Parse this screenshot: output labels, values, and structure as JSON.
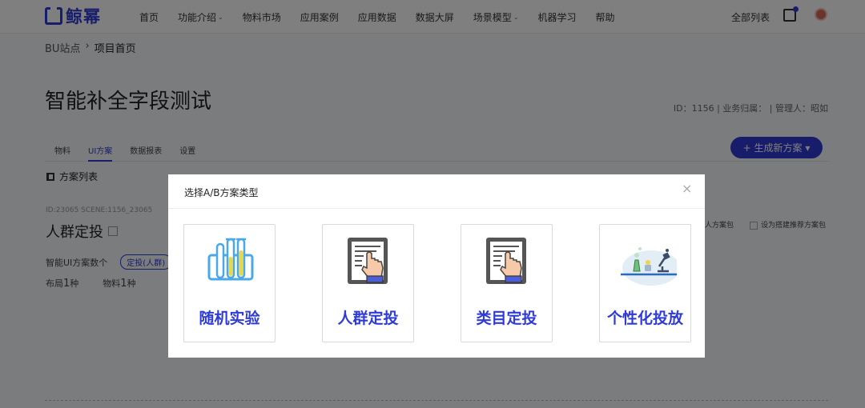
{
  "nav": {
    "logo_text": "鲸幂",
    "items": [
      {
        "label": "首页",
        "caret": ""
      },
      {
        "label": "功能介绍",
        "caret": "⌄"
      },
      {
        "label": "物料市场",
        "caret": ""
      },
      {
        "label": "应用案例",
        "caret": ""
      },
      {
        "label": "应用数据",
        "caret": ""
      },
      {
        "label": "数据大屏",
        "caret": ""
      },
      {
        "label": "场景模型",
        "caret": "⌄"
      },
      {
        "label": "机器学习",
        "caret": ""
      },
      {
        "label": "帮助",
        "caret": ""
      }
    ],
    "all_list": "全部列表"
  },
  "breadcrumb": {
    "root": "BU站点",
    "sep": "›",
    "current": "项目首页"
  },
  "page": {
    "title": "智能补全字段测试",
    "meta": "ID：1156 | 业务归属：  |  管理人：昭如"
  },
  "tabs": [
    "物料",
    "UI方案",
    "数据报表",
    "设置"
  ],
  "generate_button": "+ 生成新方案 ▾",
  "section_title": "方案列表",
  "plan": {
    "ids": "ID:23065  SCENE:1156_23065",
    "name": "人群定投",
    "options": [
      "人方案包",
      "设为搭建推荐方案包"
    ],
    "count_label": "智能UI方案数个",
    "count_pill": "定投(人群)",
    "layout_label": "布局",
    "layout_value": "1",
    "layout_unit": "种",
    "material_label": "物料",
    "material_value": "1",
    "material_unit": "种"
  },
  "modal": {
    "title": "选择A/B方案类型",
    "close": "×",
    "cards": [
      {
        "label": "随机实验",
        "icon": "test-tubes-icon"
      },
      {
        "label": "人群定投",
        "icon": "hand-document-icon"
      },
      {
        "label": "类目定投",
        "icon": "hand-document-icon"
      },
      {
        "label": "个性化投放",
        "icon": "microscope-lab-icon"
      }
    ]
  },
  "colors": {
    "accent": "#2f3bd6",
    "overlay": "rgba(0,0,0,0.5)"
  }
}
